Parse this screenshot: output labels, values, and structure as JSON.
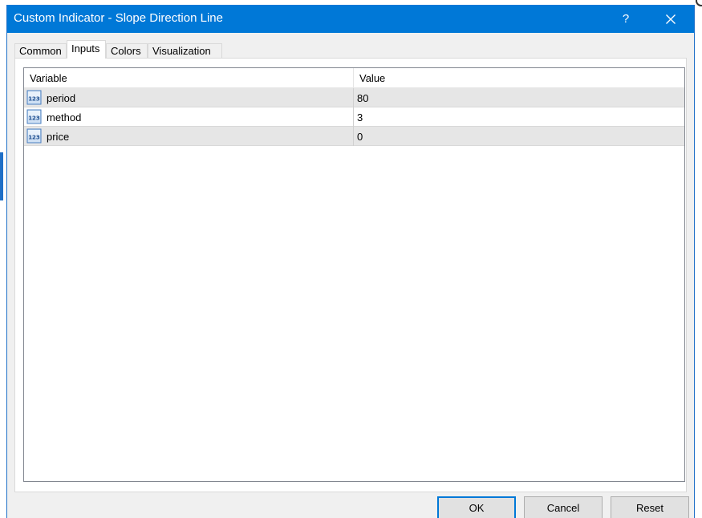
{
  "window": {
    "title": "Custom Indicator - Slope Direction Line",
    "help_label": "?",
    "close_icon": "close-icon"
  },
  "tabs": [
    {
      "label": "Common",
      "active": false
    },
    {
      "label": "Inputs",
      "active": true
    },
    {
      "label": "Colors",
      "active": false
    },
    {
      "label": "Visualization",
      "active": false
    }
  ],
  "grid": {
    "columns": [
      "Variable",
      "Value"
    ],
    "row_icon": "numeric-123-icon",
    "rows": [
      {
        "variable": "period",
        "value": "80"
      },
      {
        "variable": "method",
        "value": "3"
      },
      {
        "variable": "price",
        "value": "0"
      }
    ]
  },
  "buttons": {
    "ok_label": "OK",
    "cancel_label": "Cancel",
    "reset_label": "Reset"
  },
  "colors": {
    "titlebar": "#0078d7",
    "accent_border": "#0078d7",
    "alt_row": "#e6e6e6"
  }
}
